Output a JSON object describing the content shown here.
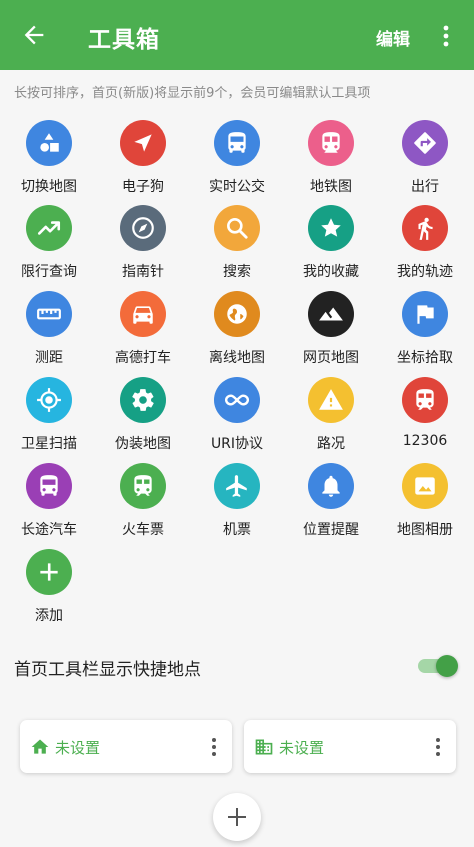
{
  "appbar": {
    "title": "工具箱",
    "edit_label": "编辑"
  },
  "hint": "长按可排序，首页(新版)将显示前9个，会员可编辑默认工具项",
  "tools": [
    {
      "label": "切换地图",
      "icon": "shapes-icon",
      "color": "#3f86e0"
    },
    {
      "label": "电子狗",
      "icon": "navigation-arrow-icon",
      "color": "#e0453a"
    },
    {
      "label": "实时公交",
      "icon": "bus-icon",
      "color": "#3f86e0"
    },
    {
      "label": "地铁图",
      "icon": "subway-icon",
      "color": "#ec5f8b"
    },
    {
      "label": "出行",
      "icon": "directions-icon",
      "color": "#8e57c4"
    },
    {
      "label": "限行查询",
      "icon": "trend-icon",
      "color": "#4caf50"
    },
    {
      "label": "指南针",
      "icon": "compass-icon",
      "color": "#5a6b7b"
    },
    {
      "label": "搜索",
      "icon": "search-icon",
      "color": "#f2a73b"
    },
    {
      "label": "我的收藏",
      "icon": "star-icon",
      "color": "#16a085"
    },
    {
      "label": "我的轨迹",
      "icon": "walk-icon",
      "color": "#e0453a"
    },
    {
      "label": "测距",
      "icon": "ruler-icon",
      "color": "#3f86e0"
    },
    {
      "label": "高德打车",
      "icon": "car-icon",
      "color": "#f36b3a"
    },
    {
      "label": "离线地图",
      "icon": "globe-icon",
      "color": "#e08a1e"
    },
    {
      "label": "网页地图",
      "icon": "mountain-icon",
      "color": "#222222"
    },
    {
      "label": "坐标拾取",
      "icon": "flag-icon",
      "color": "#3f86e0"
    },
    {
      "label": "卫星扫描",
      "icon": "gps-icon",
      "color": "#26b5e0"
    },
    {
      "label": "伪装地图",
      "icon": "gear-icon",
      "color": "#16a085"
    },
    {
      "label": "URI协议",
      "icon": "infinity-icon",
      "color": "#3f86e0"
    },
    {
      "label": "路况",
      "icon": "warning-icon",
      "color": "#f4c030"
    },
    {
      "label": "12306",
      "icon": "train-icon",
      "color": "#e0453a"
    },
    {
      "label": "长途汽车",
      "icon": "bus-icon",
      "color": "#9a3fb5"
    },
    {
      "label": "火车票",
      "icon": "train-icon",
      "color": "#4caf50"
    },
    {
      "label": "机票",
      "icon": "airplane-icon",
      "color": "#26b5c0"
    },
    {
      "label": "位置提醒",
      "icon": "bell-icon",
      "color": "#3f86e0"
    },
    {
      "label": "地图相册",
      "icon": "photo-icon",
      "color": "#f4c030"
    },
    {
      "label": "添加",
      "icon": "plus-icon",
      "color": "#4caf50"
    }
  ],
  "quick_spots": {
    "label": "首页工具栏显示快捷地点",
    "toggle_on": true,
    "cards": [
      {
        "text": "未设置",
        "icon": "home-icon"
      },
      {
        "text": "未设置",
        "icon": "building-icon"
      }
    ]
  },
  "colors": {
    "primary": "#4caf50",
    "background": "#f6f6f6"
  }
}
